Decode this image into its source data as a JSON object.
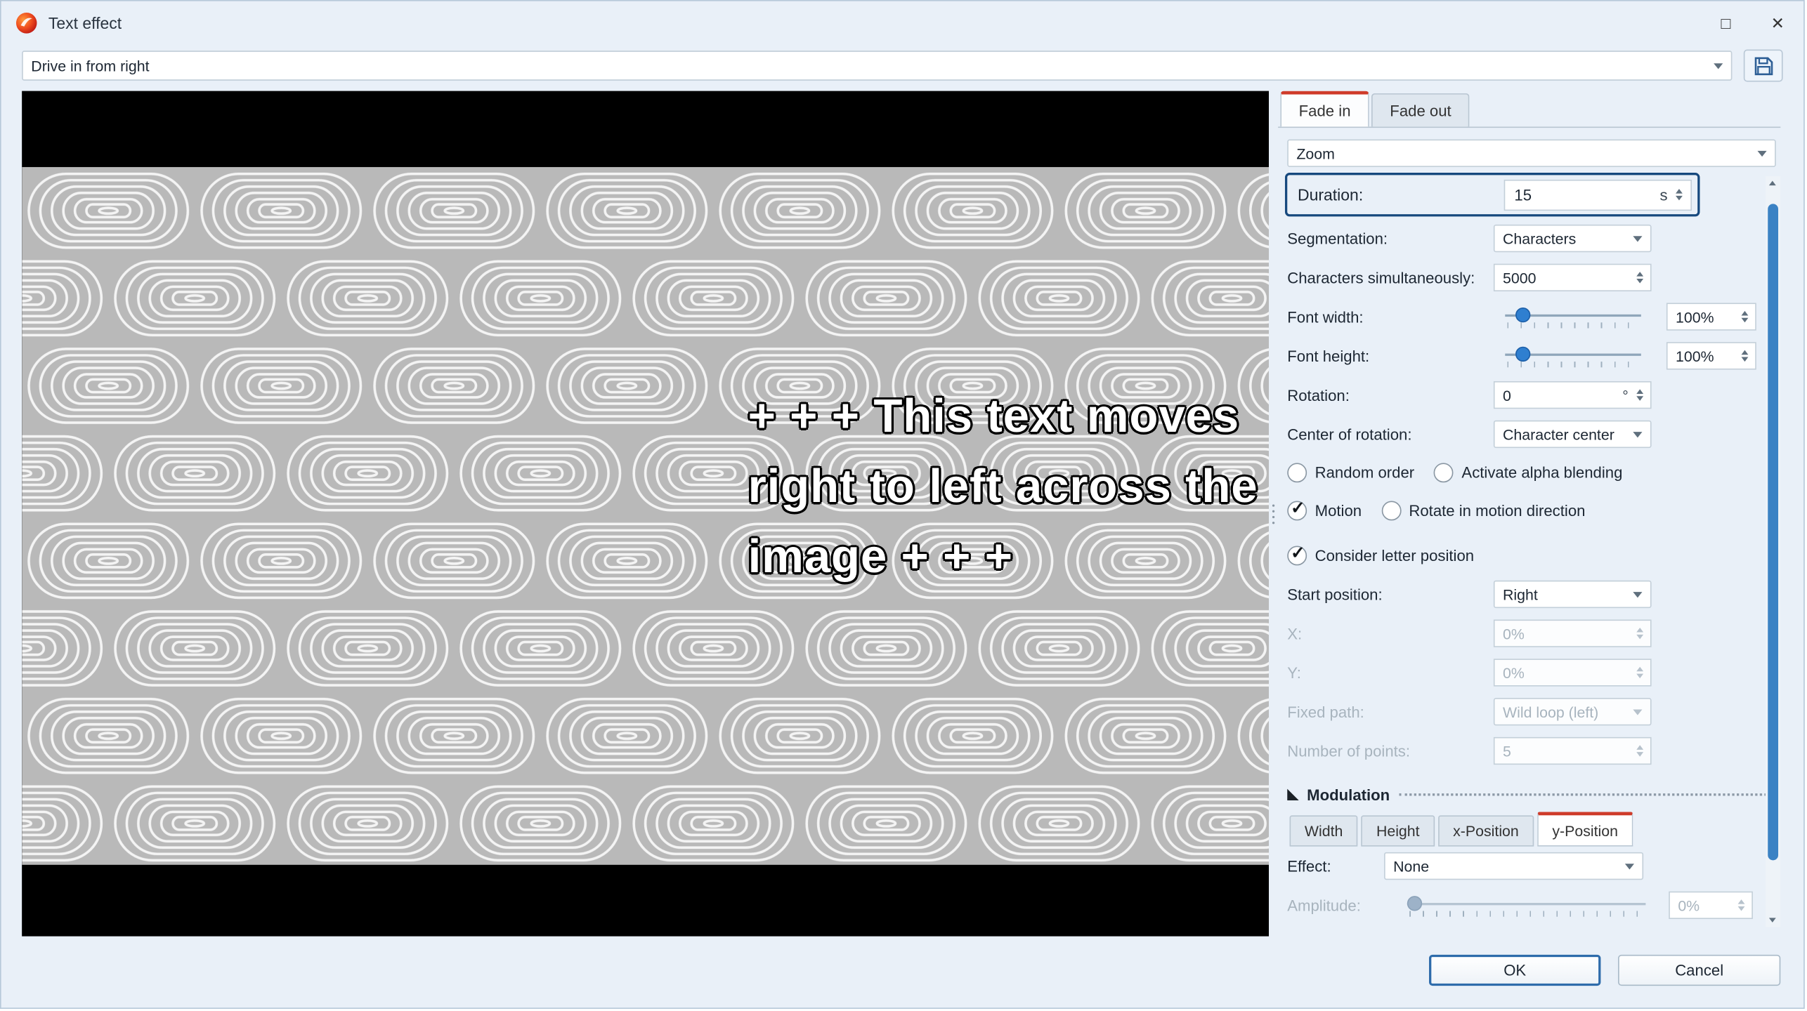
{
  "window": {
    "title": "Text effect",
    "maximize_glyph": "□",
    "close_glyph": "✕"
  },
  "toolbar": {
    "preset_value": "Drive in from right"
  },
  "preview": {
    "caption_lines": [
      "+ + + This text moves",
      "right to left across the",
      "image + + +"
    ]
  },
  "panel": {
    "tabs": {
      "fade_in": "Fade in",
      "fade_out": "Fade out"
    },
    "effect_select": "Zoom",
    "duration": {
      "label": "Duration:",
      "value": "15",
      "unit": "s"
    },
    "segmentation": {
      "label": "Segmentation:",
      "value": "Characters"
    },
    "chars_simultaneously": {
      "label": "Characters simultaneously:",
      "value": "5000"
    },
    "font_width": {
      "label": "Font width:",
      "value": "100%"
    },
    "font_height": {
      "label": "Font height:",
      "value": "100%"
    },
    "rotation": {
      "label": "Rotation:",
      "value": "0",
      "unit": "°"
    },
    "center_of_rotation": {
      "label": "Center of rotation:",
      "value": "Character center"
    },
    "checks": {
      "random_order": {
        "label": "Random order",
        "mark": ""
      },
      "alpha_blending": {
        "label": "Activate alpha blending",
        "mark": ""
      },
      "motion": {
        "label": "Motion",
        "mark": "✓"
      },
      "rotate_in_motion": {
        "label": "Rotate in motion direction",
        "mark": ""
      },
      "consider_letter": {
        "label": "Consider letter position",
        "mark": "✓"
      }
    },
    "start_position": {
      "label": "Start position:",
      "value": "Right"
    },
    "x": {
      "label": "X:",
      "value": "0%"
    },
    "y": {
      "label": "Y:",
      "value": "0%"
    },
    "fixed_path": {
      "label": "Fixed path:",
      "value": "Wild loop (left)"
    },
    "number_of_points": {
      "label": "Number of points:",
      "value": "5"
    },
    "modulation": {
      "title": "Modulation",
      "tabs": [
        "Width",
        "Height",
        "x-Position",
        "y-Position"
      ],
      "active_tab": "y-Position",
      "effect": {
        "label": "Effect:",
        "value": "None"
      },
      "amplitude": {
        "label": "Amplitude:",
        "value": "0%"
      }
    }
  },
  "footer": {
    "ok": "OK",
    "cancel": "Cancel"
  },
  "icons": {
    "app-logo-icon": "red-orange circle logo",
    "save-icon": "floppy disk",
    "dropdown-arrow-icon": "▼",
    "spin-up-icon": "▲",
    "spin-down-icon": "▼",
    "checkmark-icon": "✓",
    "collapse-triangle-icon": "◣",
    "splitter-dots-icon": "⋮"
  },
  "colors": {
    "dialog_bg": "#e9f0f8",
    "accent_blue": "#2f7fd0",
    "highlight_border": "#17497e",
    "active_tab_accent": "#cf3b2a",
    "scrollbar_thumb": "#3b82c4",
    "preview_pattern_bg": "#b9b9b9"
  }
}
